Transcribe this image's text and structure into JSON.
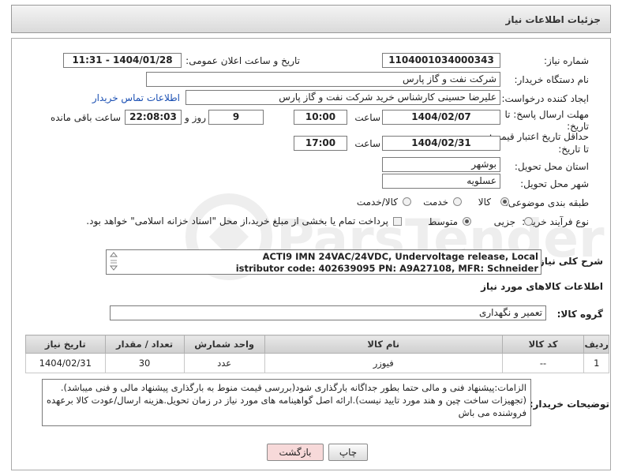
{
  "header": {
    "title": "جزئیات اطلاعات نیاز"
  },
  "form": {
    "need_number": {
      "label": "شماره نیاز:",
      "value": "1104001034000343"
    },
    "announce_datetime": {
      "label": "تاریخ و ساعت اعلان عمومی:",
      "value": "1404/01/28 - 11:31"
    },
    "buyer_org": {
      "label": "نام دستگاه خریدار:",
      "value": "شرکت نفت و گاز پارس"
    },
    "requester": {
      "label": "ایجاد کننده درخواست:",
      "value": "علیرضا حسینی کارشناس خرید شرکت نفت و گاز پارس",
      "contact_link": "اطلاعات تماس خریدار"
    },
    "reply_deadline": {
      "label_line1": "مهلت ارسال پاسخ: تا",
      "label_line2": "تاریخ:",
      "date": "1404/02/07",
      "time_label": "ساعت",
      "time": "10:00",
      "days": "9",
      "days_label": "روز و",
      "remaining": "22:08:03",
      "remaining_label": "ساعت باقی مانده"
    },
    "price_validity": {
      "label_line1": "حداقل تاریخ اعتبار قیمت:",
      "label_line2": "تا تاریخ:",
      "date": "1404/02/31",
      "time_label": "ساعت",
      "time": "17:00"
    },
    "delivery_province": {
      "label": "استان محل تحویل:",
      "value": "بوشهر"
    },
    "delivery_city": {
      "label": "شهر محل تحویل:",
      "value": "عسلویه"
    },
    "category": {
      "label": "طبقه بندی موضوعی:",
      "options": [
        "کالا",
        "خدمت",
        "کالا/خدمت"
      ],
      "selected": "کالا"
    },
    "purchase_process": {
      "label": "نوع فرآیند خرید :",
      "options": [
        "جزیی",
        "متوسط"
      ],
      "selected": "متوسط",
      "checkbox_text": "پرداخت تمام یا بخشی از مبلغ خرید،از محل \"اسناد خزانه اسلامی\" خواهد بود."
    },
    "general_description": {
      "label": "شرح کلی نیاز:",
      "line1": "ACTI9 IMN 24VAC/24VDC, Undervoltage release, Local",
      "line2": "istributor code: 402639095 PN: A9A27108, MFR: Schneider"
    }
  },
  "items_section": {
    "title": "اطلاعات کالاهای مورد نیاز",
    "group_label": "گروه کالا:",
    "group_value": "تعمیر و نگهداری",
    "table": {
      "headers": [
        "ردیف",
        "کد کالا",
        "نام کالا",
        "واحد شمارش",
        "تعداد / مقدار",
        "تاریخ نیاز"
      ],
      "rows": [
        [
          "1",
          "--",
          "فیوزر",
          "عدد",
          "30",
          "1404/02/31"
        ]
      ]
    }
  },
  "buyer_notes": {
    "label": "توضیحات خریدار:",
    "text": "الزامات:پیشنهاد فنی و مالی حتما  بطور جداگانه بارگذاری شود(بررسی قیمت منوط به بارگذاری پیشنهاد مالی و فنی میباشد).(تجهیزات ساخت چین و هند مورد تایید نیست).ارائه اصل گواهینامه های مورد نیاز در زمان تحویل.هزینه ارسال/عودت کالا برعهده فروشنده می باش"
  },
  "buttons": {
    "print": "چاپ",
    "back": "بازگشت"
  },
  "colors": {
    "back_button_bg": "#f7d9d9",
    "link": "#1a4fb3"
  }
}
